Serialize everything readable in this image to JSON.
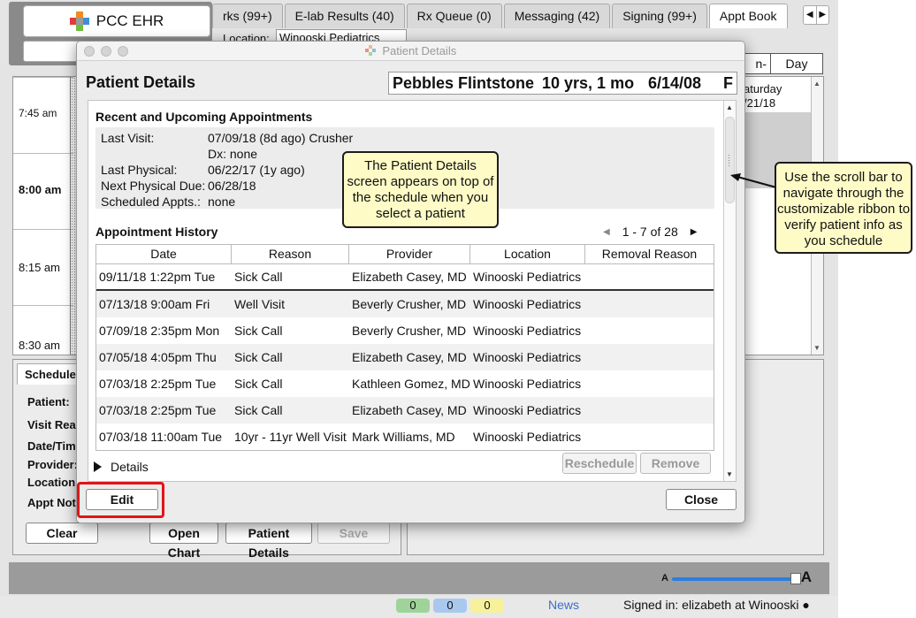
{
  "app": {
    "logo_text": "PCC EHR",
    "tabs": [
      "rks (99+)",
      "E-lab Results (40)",
      "Rx Queue (0)",
      "Messaging (42)",
      "Signing (99+)",
      "Appt Book"
    ],
    "active_tab": "Appt Book",
    "tab_arrow_left": "◀",
    "tab_arrow_right": "▶",
    "location_label": "Location:",
    "location_value": "Winooski Pediatrics",
    "view_buttons": {
      "mon_fri": "n-Fri",
      "day": "Day"
    },
    "time_slots": [
      "7:45 am",
      "8:00 am",
      "8:15 am",
      "8:30 am"
    ],
    "saturday_header": "aturday",
    "saturday_date": "/21/18",
    "form": {
      "tab_label": "Schedule",
      "labels": [
        "Patient:",
        "Visit Rea",
        "Date/Tim",
        "Provider:",
        "Location:",
        "Appt Not"
      ]
    },
    "buttons": {
      "clear": "Clear",
      "open_chart": "Open Chart",
      "patient_details": "Patient Details",
      "save": "Save"
    },
    "font_small": "A",
    "font_large": "A",
    "status_badges": [
      {
        "value": "0",
        "color": "#9fd39a"
      },
      {
        "value": "0",
        "color": "#a9c8ee"
      },
      {
        "value": "0",
        "color": "#f6f19a"
      }
    ],
    "news": "News",
    "signed_in": "Signed in: elizabeth at Winooski ●"
  },
  "modal": {
    "window_title": "Patient Details",
    "heading": "Patient Details",
    "patient": {
      "name": "Pebbles Flintstone",
      "age": "10 yrs, 1 mo",
      "dob": "6/14/08",
      "sex": "F"
    },
    "recent_title": "Recent and Upcoming Appointments",
    "recent": [
      {
        "label": "Last Visit:",
        "value": "07/09/18 (8d ago)  Crusher"
      },
      {
        "label": "",
        "value": "Dx: none"
      },
      {
        "label": "Last Physical:",
        "value": "06/22/17 (1y ago)"
      },
      {
        "label": "Next Physical Due:",
        "value": "06/28/18"
      },
      {
        "label": "Scheduled Appts.:",
        "value": "none"
      }
    ],
    "history_title": "Appointment History",
    "pager": {
      "text": "1 - 7 of 28",
      "prev": "◀",
      "next": "▶"
    },
    "columns": [
      "Date",
      "Reason",
      "Provider",
      "Location",
      "Removal Reason"
    ],
    "rows": [
      [
        "09/11/18  1:22pm Tue",
        "Sick Call",
        "Elizabeth Casey, MD",
        "Winooski Pediatrics",
        ""
      ],
      [
        "07/13/18  9:00am Fri",
        "Well Visit",
        "Beverly Crusher, MD",
        "Winooski Pediatrics",
        ""
      ],
      [
        "07/09/18  2:35pm Mon",
        "Sick Call",
        "Beverly Crusher, MD",
        "Winooski Pediatrics",
        ""
      ],
      [
        "07/05/18  4:05pm Thu",
        "Sick Call",
        "Elizabeth Casey, MD",
        "Winooski Pediatrics",
        ""
      ],
      [
        "07/03/18  2:25pm Tue",
        "Sick Call",
        "Kathleen Gomez, MD",
        "Winooski Pediatrics",
        ""
      ],
      [
        "07/03/18  2:25pm Tue",
        "Sick Call",
        "Elizabeth Casey, MD",
        "Winooski Pediatrics",
        ""
      ],
      [
        "07/03/18  11:00am Tue",
        "10yr - 11yr Well Visit",
        "Mark Williams, MD",
        "Winooski Pediatrics",
        ""
      ]
    ],
    "details_label": "Details",
    "reschedule": "Reschedule",
    "remove": "Remove",
    "edit": "Edit",
    "close": "Close"
  },
  "callouts": {
    "details_note": "The Patient Details screen appears on top of the schedule when you select a patient",
    "scroll_note": "Use the scroll bar to navigate through the customizable ribbon to verify patient info as you schedule"
  },
  "colors": {
    "highlight": "#e0151a",
    "callout_bg": "#fefbc6",
    "slider": "#2a7fe0"
  }
}
